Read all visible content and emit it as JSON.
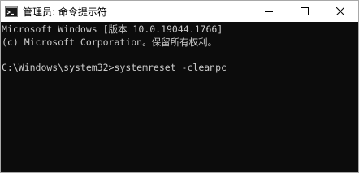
{
  "window": {
    "title": "管理员: 命令提示符",
    "icon": "cmd-icon"
  },
  "controls": {
    "minimize_icon": "minimize-icon",
    "maximize_icon": "maximize-icon",
    "close_icon": "close-icon"
  },
  "console": {
    "lines": [
      "Microsoft Windows [版本 10.0.19044.1766]",
      "(c) Microsoft Corporation。保留所有权利。",
      "C:\\Windows\\system32>systemreset -cleanpc"
    ]
  },
  "colors": {
    "console_bg": "#0c0c0c",
    "console_text": "#cccccc",
    "titlebar_bg": "#ffffff"
  }
}
